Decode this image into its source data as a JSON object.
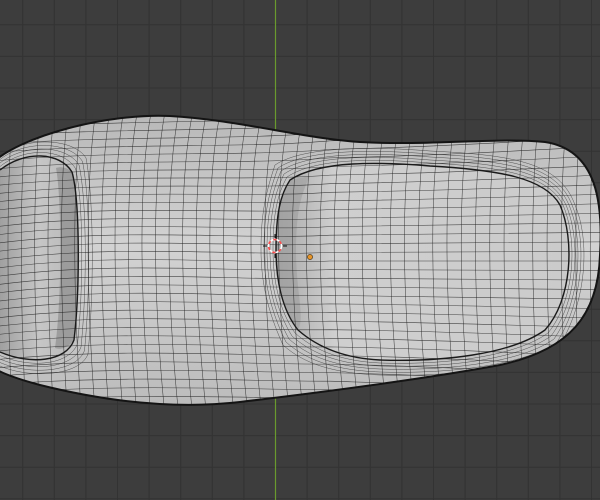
{
  "viewport": {
    "view": "top-orthographic",
    "object_shading": "solid-wireframe",
    "colors": {
      "background": "#3d3d3d",
      "grid_line": "#333333",
      "y_axis": "#6a9a2e",
      "mesh_fill": "#c4c4c4",
      "mesh_shadow": "#9a9a9a",
      "wire": "#1e1e1e",
      "origin": "#e5942a",
      "cursor_red": "#ff4a4a",
      "cursor_white": "#ffffff"
    }
  }
}
